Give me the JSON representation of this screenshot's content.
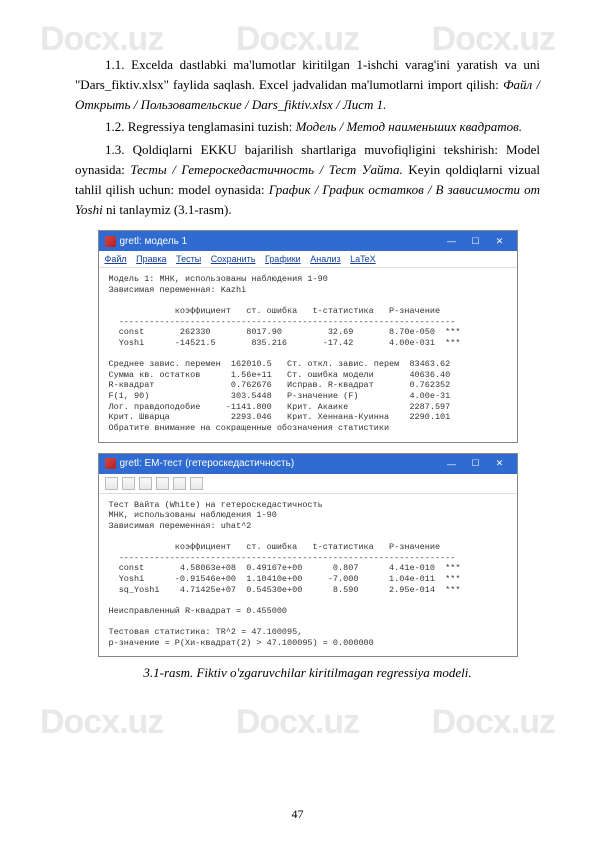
{
  "watermark": "Docx.uz",
  "paragraphs": {
    "p1_a": "1.1. Excelda dastlabki ma'lumotlar kiritilgan 1-ishchi varag'ini yaratish va uni \"Dars_fiktiv.xlsx\" faylida saqlash. Excel jadvalidan ma'lumotlarni import qilish: ",
    "p1_i": "Файл / Открыть / Пользовательские / Dars_fiktiv.xlsx / Лист 1.",
    "p2_a": "1.2. Regressiya tenglamasini tuzish: ",
    "p2_i": "Модель / Метод наименьших квадратов.",
    "p3_a": "1.3. Qoldiqlarni EKKU bajarilish shartlariga muvofiqligini tekshirish: Model oynasida: ",
    "p3_i1": "Тесты / Гетероскедастичность / Тест Уайта.",
    "p3_b": " Keyin qoldiqlarni vizual tahlil qilish uchun: model oynasida: ",
    "p3_i2": "График / График остатков / В зависимости от Yoshi ",
    "p3_c": "ni tanlaymiz (3.1-rasm)."
  },
  "win1": {
    "title": "gretl: модель 1",
    "menus": [
      "Файл",
      "Правка",
      "Тесты",
      "Сохранить",
      "Графики",
      "Анализ",
      "LaTeX"
    ],
    "text": "Модель 1: МНК, использованы наблюдения 1-90\nЗависимая переменная: Kazhi\n\n             коэффициент   ст. ошибка   t-статистика   P-значение\n  ------------------------------------------------------------------\n  const       262330       8017.90         32.69       8.70e-050  ***\n  Yoshi      -14521.5       835.216       -17.42       4.00e-031  ***\n\nСреднее завис. перемен  162010.5   Ст. откл. завис. перем  83463.62\nСумма кв. остатков      1.56e+11   Ст. ошибка модели       40636.40\nR-квадрат               0.762676   Исправ. R-квадрат       0.762352\nF(1, 90)                303.5448   Р-значение (F)          4.00e-31\nЛог. правдоподобие     -1141.800   Крит. Акаике            2287.597\nКрит. Шварца            2293.046   Крит. Хеннана-Куинна    2290.101\nОбратите внимание на сокращенные обозначения статистики"
  },
  "win2": {
    "title": "gretl: ЕМ-тест (гетероскедастичность)",
    "text": "Тест Вайта (White) на гетероскедастичность\nМНК, использованы наблюдения 1-90\nЗависимая переменная: uhat^2\n\n             коэффициент   ст. ошибка   t-статистика   P-значение\n  ------------------------------------------------------------------\n  const       4.58063e+08  0.49167e+00      0.807      4.41e-010  ***\n  Yoshi      -0.91546e+00  1.10410e+00     -7.000      1.04e-011  ***\n  sq_Yoshi    4.71425e+07  0.54530e+00      8.590      2.95e-014  ***\n\nНеисправленный R-квадрат = 0.455000\n\nТестовая статистика: TR^2 = 47.100095,\nр-значение = P(Хи-квадрат(2) > 47.100095) = 0.000000"
  },
  "caption": "3.1-rasm. Fiktiv o'zgaruvchilar kiritilmagan regressiya modeli.",
  "page_number": "47"
}
